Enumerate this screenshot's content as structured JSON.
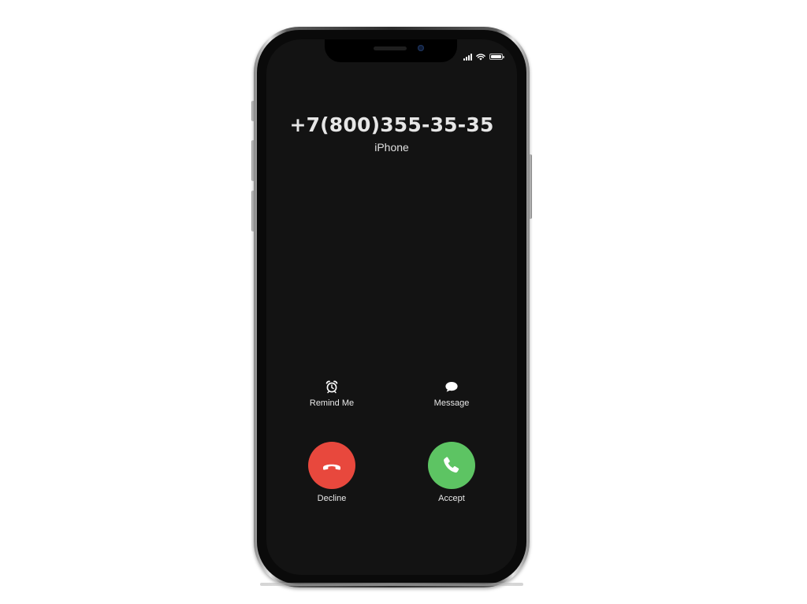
{
  "caller": {
    "number": "+7(800)355-35-35",
    "label": "iPhone"
  },
  "actions": {
    "remind_me": {
      "label": "Remind Me",
      "icon": "alarm-clock-icon"
    },
    "message": {
      "label": "Message",
      "icon": "speech-bubble-icon"
    }
  },
  "call_buttons": {
    "decline": {
      "label": "Decline",
      "icon": "phone-hangup-icon",
      "color": "#e8483d"
    },
    "accept": {
      "label": "Accept",
      "icon": "phone-icon",
      "color": "#5dc463"
    }
  },
  "status_bar": {
    "icons": [
      "cellular-signal-icon",
      "wifi-icon",
      "battery-icon"
    ]
  }
}
